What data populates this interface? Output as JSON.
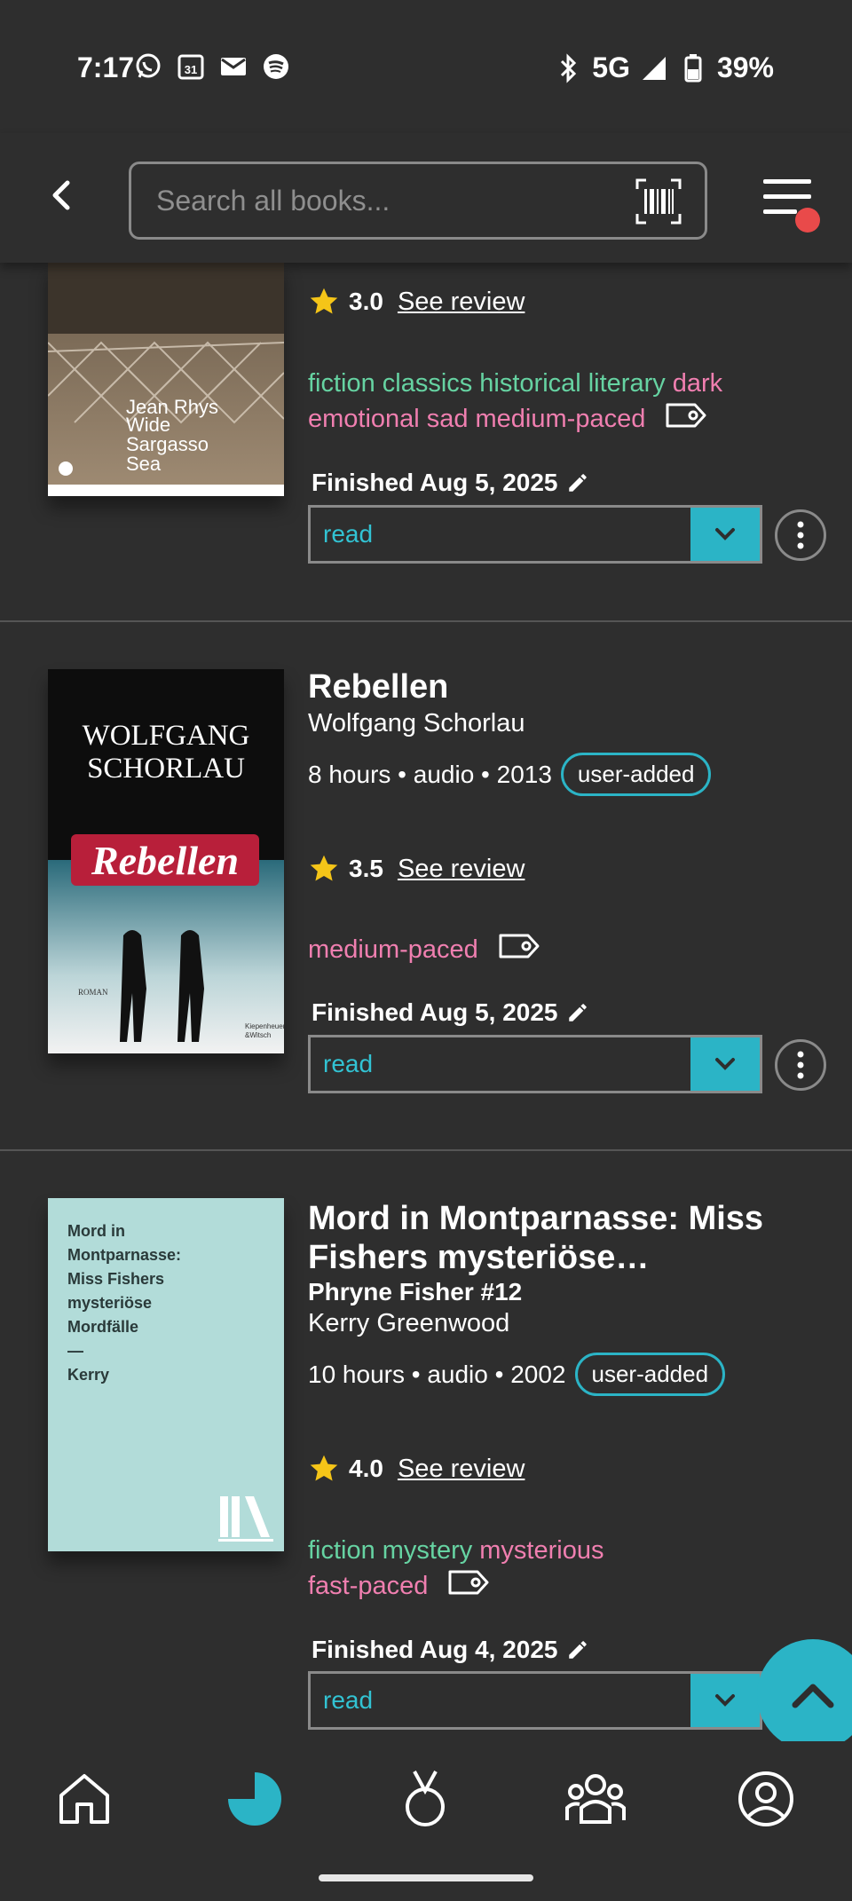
{
  "status_bar": {
    "time": "7:17",
    "network": "5G",
    "battery": "39%"
  },
  "header": {
    "search_placeholder": "Search all books..."
  },
  "books": [
    {
      "cover_author": "Jean Rhys",
      "cover_title": "Wide Sargasso Sea",
      "rating": "3.0",
      "review_link": "See review",
      "tags_green": [
        "fiction",
        "classics",
        "historical",
        "literary"
      ],
      "tags_pink": [
        "dark",
        "emotional",
        "sad",
        "medium-paced"
      ],
      "finished": "Finished Aug 5, 2025",
      "status": "read"
    },
    {
      "title": "Rebellen",
      "author": "Wolfgang Schorlau",
      "meta": "8 hours • audio • 2013",
      "badge": "user-added",
      "cover_author": "WOLFGANG SCHORLAU",
      "cover_title": "Rebellen",
      "cover_small_left": "ROMAN",
      "cover_small_right": "Kiepenheuer & Witsch",
      "rating": "3.5",
      "review_link": "See review",
      "tags_pink": [
        "medium-paced"
      ],
      "finished": "Finished Aug 5, 2025",
      "status": "read"
    },
    {
      "title": "Mord in Montparnasse: Miss Fishers mysteriöse…",
      "series": "Phryne Fisher #12",
      "author": "Kerry Greenwood",
      "meta": "10 hours • audio • 2002",
      "badge": "user-added",
      "cover_text": [
        "Mord in",
        "Montparnasse:",
        "Miss Fishers",
        "mysteriöse",
        "Mordfälle",
        "—",
        "Kerry"
      ],
      "rating": "4.0",
      "review_link": "See review",
      "tags_green": [
        "fiction",
        "mystery"
      ],
      "tags_pink": [
        "mysterious",
        "fast-paced"
      ],
      "finished": "Finished Aug 4, 2025",
      "status": "read"
    }
  ],
  "colors": {
    "accent": "#2bb4c6",
    "tag_green": "#66d3a2",
    "tag_pink": "#f07fb0",
    "star": "#f5c518",
    "notification": "#e94a4a"
  },
  "nav": [
    "home-icon",
    "stats-icon",
    "challenges-icon",
    "community-icon",
    "profile-icon"
  ]
}
